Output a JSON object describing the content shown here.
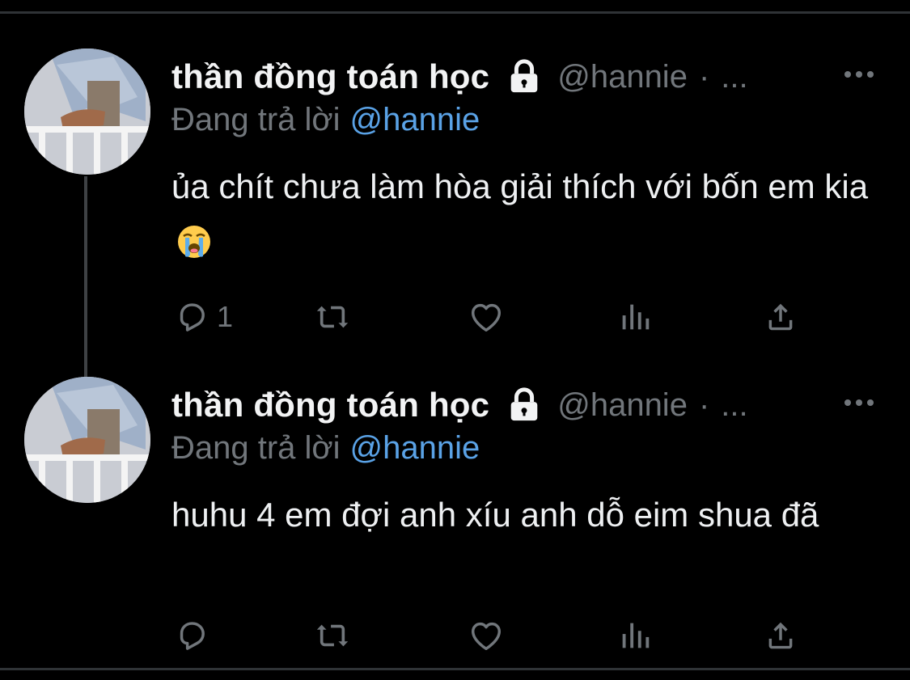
{
  "tweets": [
    {
      "display_name": "thần đồng toán học",
      "handle": "@hannie",
      "separator": "·",
      "time_truncated": "...",
      "replying_label": "Đang trả lời",
      "replying_to": "@hannie",
      "text": "ủa chít chưa làm hòa giải thích với bốn em kia",
      "emoji": "loudly-crying-face",
      "reply_count": "1"
    },
    {
      "display_name": "thần đồng toán học",
      "handle": "@hannie",
      "separator": "·",
      "time_truncated": "...",
      "replying_label": "Đang trả lời",
      "replying_to": "@hannie",
      "text": "huhu 4 em đợi anh xíu anh dỗ eim shua đã",
      "reply_count": ""
    }
  ],
  "icons": {
    "lock": "lock-icon",
    "more": "more-icon",
    "reply": "reply-icon",
    "retweet": "retweet-icon",
    "like": "heart-icon",
    "views": "views-icon",
    "share": "share-icon"
  },
  "colors": {
    "background": "#000000",
    "text": "#e7e9ea",
    "secondary": "#71767b",
    "link": "#5aa2e6",
    "divider": "#2f3336"
  }
}
